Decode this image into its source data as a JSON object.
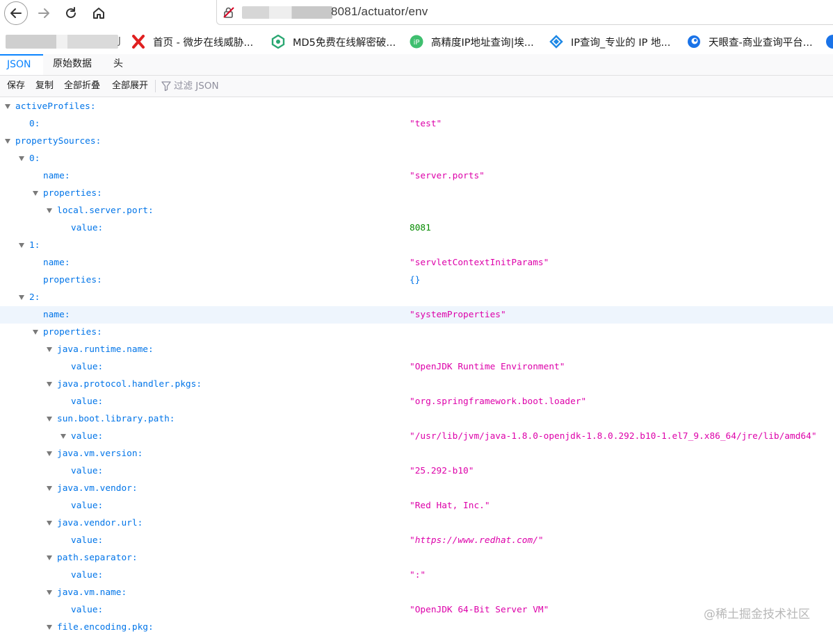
{
  "browser": {
    "url_visible": "8081/actuator/env"
  },
  "bookmarks": [
    {
      "label": "J",
      "icon": "blurred-bookmark"
    },
    {
      "label": "首页 - 微步在线威胁...",
      "icon": "threatbook-x-icon",
      "color": "#e02020"
    },
    {
      "label": "MD5免费在线解密破...",
      "icon": "md5-icon",
      "color": "#2aa772"
    },
    {
      "label": "高精度IP地址查询|埃...",
      "icon": "ip-icon",
      "color": "#3fbf6f"
    },
    {
      "label": "IP查询_专业的 IP 地...",
      "icon": "ip-query-icon",
      "color": "#1e88e5"
    },
    {
      "label": "天眼查-商业查询平台...",
      "icon": "tianyancha-icon",
      "color": "#1a73e8"
    }
  ],
  "viewer_tabs": [
    {
      "label": "JSON",
      "active": true
    },
    {
      "label": "原始数据",
      "active": false
    },
    {
      "label": "头",
      "active": false
    }
  ],
  "toolbar": {
    "save": "保存",
    "copy": "复制",
    "collapse_all": "全部折叠",
    "expand_all": "全部展开",
    "filter_placeholder": "过滤 JSON"
  },
  "json_rows": [
    {
      "key": "activeProfiles:",
      "depth": 0,
      "twisty": true,
      "value": ""
    },
    {
      "key": "0:",
      "depth": 1,
      "twisty": false,
      "value": "\"test\"",
      "type": "string"
    },
    {
      "key": "propertySources:",
      "depth": 0,
      "twisty": true,
      "value": ""
    },
    {
      "key": "0:",
      "depth": 1,
      "twisty": true,
      "value": ""
    },
    {
      "key": "name:",
      "depth": 2,
      "twisty": false,
      "value": "\"server.ports\"",
      "type": "string"
    },
    {
      "key": "properties:",
      "depth": 2,
      "twisty": true,
      "value": ""
    },
    {
      "key": "local.server.port:",
      "depth": 3,
      "twisty": true,
      "value": ""
    },
    {
      "key": "value:",
      "depth": 4,
      "twisty": false,
      "value": "8081",
      "type": "number"
    },
    {
      "key": "1:",
      "depth": 1,
      "twisty": true,
      "value": ""
    },
    {
      "key": "name:",
      "depth": 2,
      "twisty": false,
      "value": "\"servletContextInitParams\"",
      "type": "string"
    },
    {
      "key": "properties:",
      "depth": 2,
      "twisty": false,
      "value": "{}",
      "type": "object"
    },
    {
      "key": "2:",
      "depth": 1,
      "twisty": true,
      "value": ""
    },
    {
      "key": "name:",
      "depth": 2,
      "twisty": false,
      "value": "\"systemProperties\"",
      "type": "string",
      "highlighted": true
    },
    {
      "key": "properties:",
      "depth": 2,
      "twisty": true,
      "value": ""
    },
    {
      "key": "java.runtime.name:",
      "depth": 3,
      "twisty": true,
      "value": ""
    },
    {
      "key": "value:",
      "depth": 4,
      "twisty": false,
      "value": "\"OpenJDK Runtime Environment\"",
      "type": "string"
    },
    {
      "key": "java.protocol.handler.pkgs:",
      "depth": 3,
      "twisty": true,
      "value": ""
    },
    {
      "key": "value:",
      "depth": 4,
      "twisty": false,
      "value": "\"org.springframework.boot.loader\"",
      "type": "string"
    },
    {
      "key": "sun.boot.library.path:",
      "depth": 3,
      "twisty": true,
      "value": ""
    },
    {
      "key": "value:",
      "depth": 4,
      "twisty": true,
      "value": "\"/usr/lib/jvm/java-1.8.0-openjdk-1.8.0.292.b10-1.el7_9.x86_64/jre/lib/amd64\"",
      "type": "string"
    },
    {
      "key": "java.vm.version:",
      "depth": 3,
      "twisty": true,
      "value": ""
    },
    {
      "key": "value:",
      "depth": 4,
      "twisty": false,
      "value": "\"25.292-b10\"",
      "type": "string"
    },
    {
      "key": "java.vm.vendor:",
      "depth": 3,
      "twisty": true,
      "value": ""
    },
    {
      "key": "value:",
      "depth": 4,
      "twisty": false,
      "value": "\"Red Hat, Inc.\"",
      "type": "string"
    },
    {
      "key": "java.vendor.url:",
      "depth": 3,
      "twisty": true,
      "value": ""
    },
    {
      "key": "value:",
      "depth": 4,
      "twisty": false,
      "value": "\"https://www.redhat.com/\"",
      "type": "url"
    },
    {
      "key": "path.separator:",
      "depth": 3,
      "twisty": true,
      "value": ""
    },
    {
      "key": "value:",
      "depth": 4,
      "twisty": false,
      "value": "\":\"",
      "type": "string"
    },
    {
      "key": "java.vm.name:",
      "depth": 3,
      "twisty": true,
      "value": ""
    },
    {
      "key": "value:",
      "depth": 4,
      "twisty": false,
      "value": "\"OpenJDK 64-Bit Server VM\"",
      "type": "string"
    },
    {
      "key": "file.encoding.pkg:",
      "depth": 3,
      "twisty": true,
      "value": ""
    }
  ],
  "watermark": "@稀土掘金技术社区"
}
